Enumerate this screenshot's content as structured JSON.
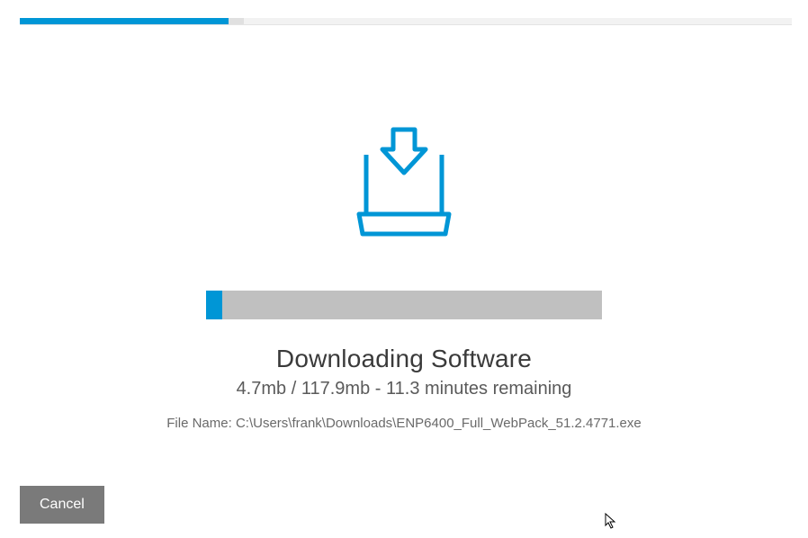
{
  "topProgress": {
    "percent": 27
  },
  "download": {
    "title": "Downloading Software",
    "downloadedMb": "4.7",
    "totalMb": "117.9",
    "mbUnit": "mb",
    "separator1": " / ",
    "separator2": " - ",
    "minutesRemaining": "11.3",
    "minutesLabel": "minutes remaining",
    "progressPercent": 4,
    "fileNameLabel": "File Name: ",
    "fileName": "C:\\Users\\frank\\Downloads\\ENP6400_Full_WebPack_51.2.4771.exe"
  },
  "buttons": {
    "cancel": "Cancel"
  },
  "colors": {
    "accent": "#0096d6"
  }
}
